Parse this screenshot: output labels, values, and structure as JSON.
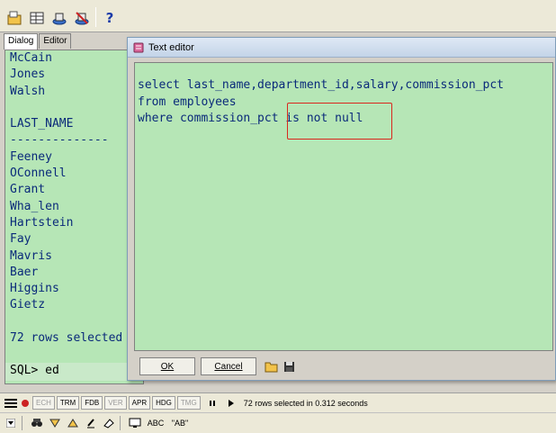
{
  "tabs": [
    "Dialog",
    "Editor"
  ],
  "output": {
    "lines": [
      "McCain",
      "Jones",
      "Walsh",
      "",
      "LAST_NAME",
      "--------------",
      "Feeney",
      "OConnell",
      "Grant",
      "Wha_len",
      "Hartstein",
      "Fay",
      "Mavris",
      "Baer",
      "Higgins",
      "Gietz",
      "",
      "72 rows selected"
    ],
    "prompt": "SQL> ed"
  },
  "dialog": {
    "title": "Text editor",
    "code": [
      "select last_name,department_id,salary,commission_pct",
      "from employees",
      "where commission_pct is not null"
    ],
    "ok_label": "OK",
    "cancel_label": "Cancel"
  },
  "statusbar": {
    "indicators": [
      "ECH",
      "TRM",
      "FDB",
      "VER",
      "APR",
      "HDG",
      "TMG"
    ],
    "dim_indicators": [
      "ECH",
      "VER",
      "TMG"
    ],
    "message": "72 rows selected in 0.312 seconds"
  },
  "bottombar": {
    "abc_label": "ABC",
    "quote_label": "\"AB\""
  },
  "colors": {
    "pane_bg": "#b6e6b6",
    "code_text": "#0a2a7a",
    "highlight_border": "#d9281e"
  }
}
